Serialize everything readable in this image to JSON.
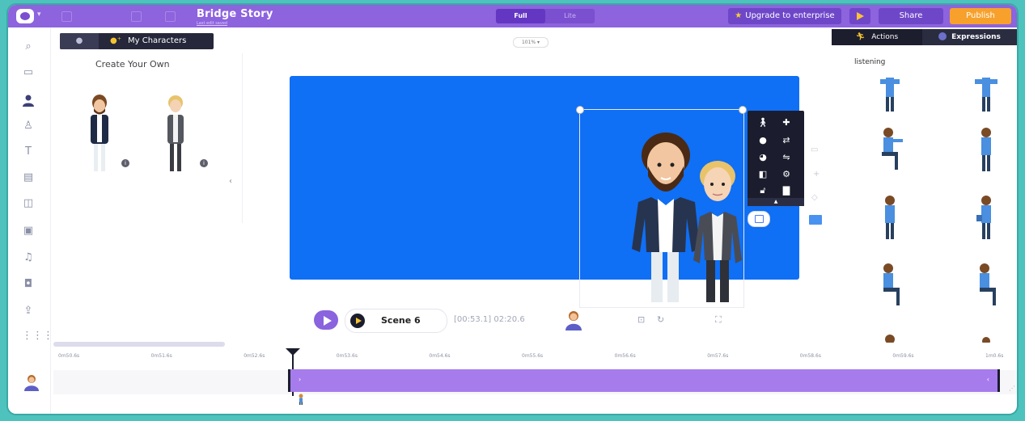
{
  "header": {
    "story_title": "Bridge Story",
    "story_subtitle": "Last edit saved",
    "view_full": "Full",
    "view_lite": "Lite",
    "upgrade": "Upgrade to enterprise",
    "share": "Share",
    "publish": "Publish"
  },
  "left_panel": {
    "tab_my_characters": "My Characters",
    "create_your_own": "Create Your Own"
  },
  "canvas": {
    "zoom": "101% ▾"
  },
  "right_panel": {
    "tab_actions": "Actions",
    "tab_expressions": "Expressions",
    "category": "listening"
  },
  "playback": {
    "scene_label": "Scene 6",
    "timecode": "[00:53.1] 02:20.6"
  },
  "timeline": {
    "ticks": [
      "0m50.6s",
      "0m51.6s",
      "0m52.6s",
      "0m53.6s",
      "0m54.6s",
      "0m55.6s",
      "0m56.6s",
      "0m57.6s",
      "0m58.6s",
      "0m59.6s",
      "1m0.6s"
    ]
  },
  "colors": {
    "topbar": "#8d63de",
    "stage": "#0f6ff5",
    "track": "#a67cec",
    "publish": "#f7a12c",
    "accent_yellow": "#f4c430"
  }
}
